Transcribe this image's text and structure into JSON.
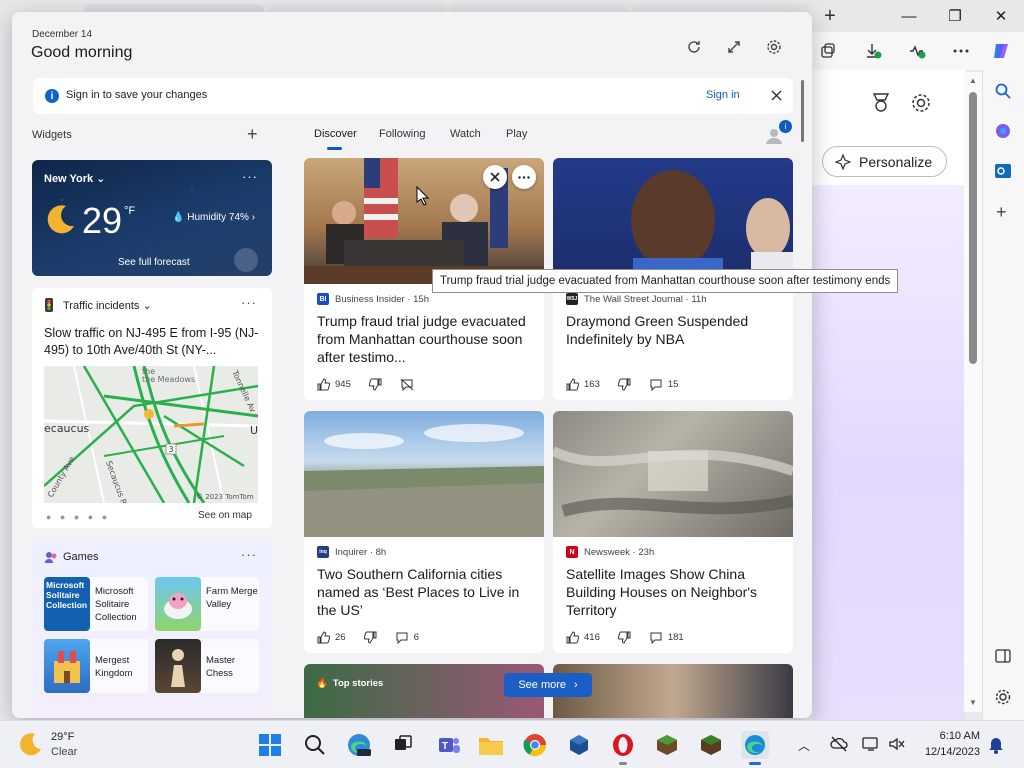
{
  "panel": {
    "date": "December 14",
    "greeting": "Good morning"
  },
  "signin_bar": {
    "message": "Sign in to save your changes",
    "link": "Sign in"
  },
  "widgets": {
    "label": "Widgets",
    "add": "+"
  },
  "feed_tabs": [
    "Discover",
    "Following",
    "Watch",
    "Play"
  ],
  "avatar_badge": "i",
  "weather": {
    "location": "New York",
    "temp": "29",
    "unit": "°F",
    "humidity": "Humidity 74%",
    "forecast_link": "See full forecast"
  },
  "traffic": {
    "title": "Traffic incidents",
    "description": "Slow traffic on NJ-495 E from I-95 (NJ-495) to 10th Ave/40th St (NY-...",
    "map_labels": {
      "meadows": "the Meadows",
      "secaucus": "ecaucus",
      "secaucus_rd": "Secaucus Rd",
      "tonnelle": "Tonnelle Av",
      "county": "County Ave",
      "u": "U",
      "route3": "3",
      "copyright": "© 2023 TomTom"
    },
    "see_map": "See on map"
  },
  "games": {
    "title": "Games",
    "items": [
      {
        "name": "Microsoft Solitaire Collection",
        "art_text": "Microsoft Solitaire Collection"
      },
      {
        "name": "Farm Merge Valley"
      },
      {
        "name": "Mergest Kingdom"
      },
      {
        "name": "Master Chess"
      }
    ]
  },
  "cards": [
    {
      "source": "Business Insider · 15h",
      "logo": "BI",
      "logo_color": "#1a4bc9",
      "title": "Trump fraud trial judge evacuated from Manhattan courthouse soon after testimo...",
      "likes": "945"
    },
    {
      "source": "The Wall Street Journal · 11h",
      "logo": "WSJ",
      "logo_color": "#222222",
      "title": "Draymond Green Suspended Indefinitely by NBA",
      "likes": "163",
      "comments": "15"
    },
    {
      "source": "Inquirer · 8h",
      "logo": "inq",
      "logo_color": "#1f3f7f",
      "title": "Two Southern California cities named as ‘Best Places to Live in the US’",
      "likes": "26",
      "comments": "6"
    },
    {
      "source": "Newsweek · 23h",
      "logo": "N",
      "logo_color": "#d0021b",
      "title": "Satellite Images Show China Building Houses on Neighbor's Territory",
      "likes": "416",
      "comments": "181"
    }
  ],
  "tooltip": "Trump fraud trial judge evacuated from Manhattan courthouse soon after testimony ends",
  "top_stories": "Top stories",
  "see_more": "See more",
  "browser": {
    "personalize": "Personalize"
  },
  "taskbar": {
    "weather_temp": "29°F",
    "weather_cond": "Clear",
    "time": "6:10 AM",
    "date": "12/14/2023"
  },
  "colors": {
    "accent": "#0f5cc0",
    "see_more_bg": "#1b5fc6",
    "weather_bg": "#16325c"
  }
}
